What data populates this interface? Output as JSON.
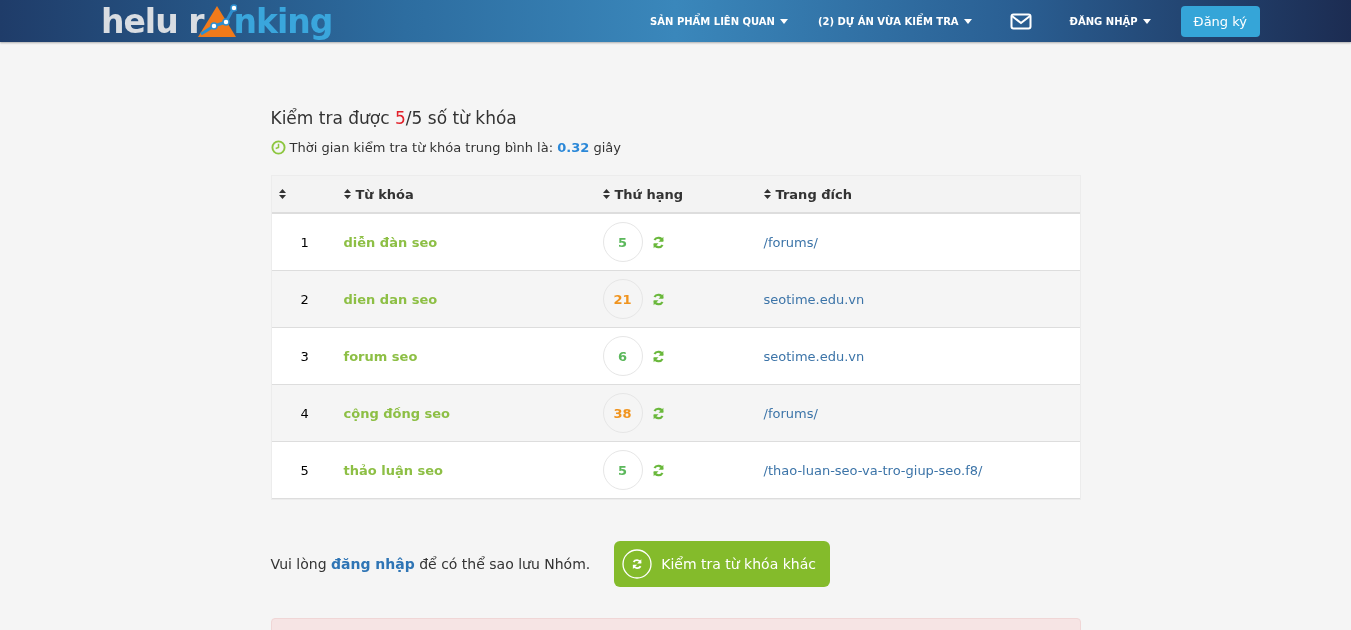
{
  "logo": {
    "left": "helu r",
    "right": "nking"
  },
  "nav": [
    {
      "label": "SẢN PHẨM LIÊN QUAN",
      "kind": "dropdown"
    },
    {
      "label": "(2) DỰ ÁN VỪA KIỂM TRA",
      "kind": "dropdown"
    },
    {
      "kind": "mail"
    },
    {
      "label": "ĐĂNG NHẬP",
      "kind": "dropdown"
    },
    {
      "label": "Đăng ký",
      "kind": "button"
    }
  ],
  "summary": {
    "title_before": "Kiểm tra được ",
    "checked": "5",
    "title_after": "/5 số từ khóa",
    "time_label": "Thời gian kiểm tra từ khóa trung bình là: ",
    "time_value": "0.32",
    "time_unit": " giây"
  },
  "table": {
    "columns": [
      "",
      "Từ khóa",
      "Thứ hạng",
      "Trang đích"
    ],
    "rows": [
      {
        "index": "1",
        "keyword": "diễn đàn seo",
        "rank": "5",
        "color": "#5cb85c",
        "target": "/forums/"
      },
      {
        "index": "2",
        "keyword": "dien dan seo",
        "rank": "21",
        "color": "#f0941f",
        "target": "seotime.edu.vn"
      },
      {
        "index": "3",
        "keyword": "forum seo",
        "rank": "6",
        "color": "#5cb85c",
        "target": "seotime.edu.vn"
      },
      {
        "index": "4",
        "keyword": "cộng đồng seo",
        "rank": "38",
        "color": "#f0941f",
        "target": "/forums/"
      },
      {
        "index": "5",
        "keyword": "thảo luận seo",
        "rank": "5",
        "color": "#5cb85c",
        "target": "/thao-luan-seo-va-tro-giup-seo.f8/"
      }
    ]
  },
  "footer": {
    "before": "Vui lòng ",
    "link": "đăng nhập",
    "after": " để có thể sao lưu Nhóm.",
    "button": "Kiểm tra từ khóa khác"
  }
}
